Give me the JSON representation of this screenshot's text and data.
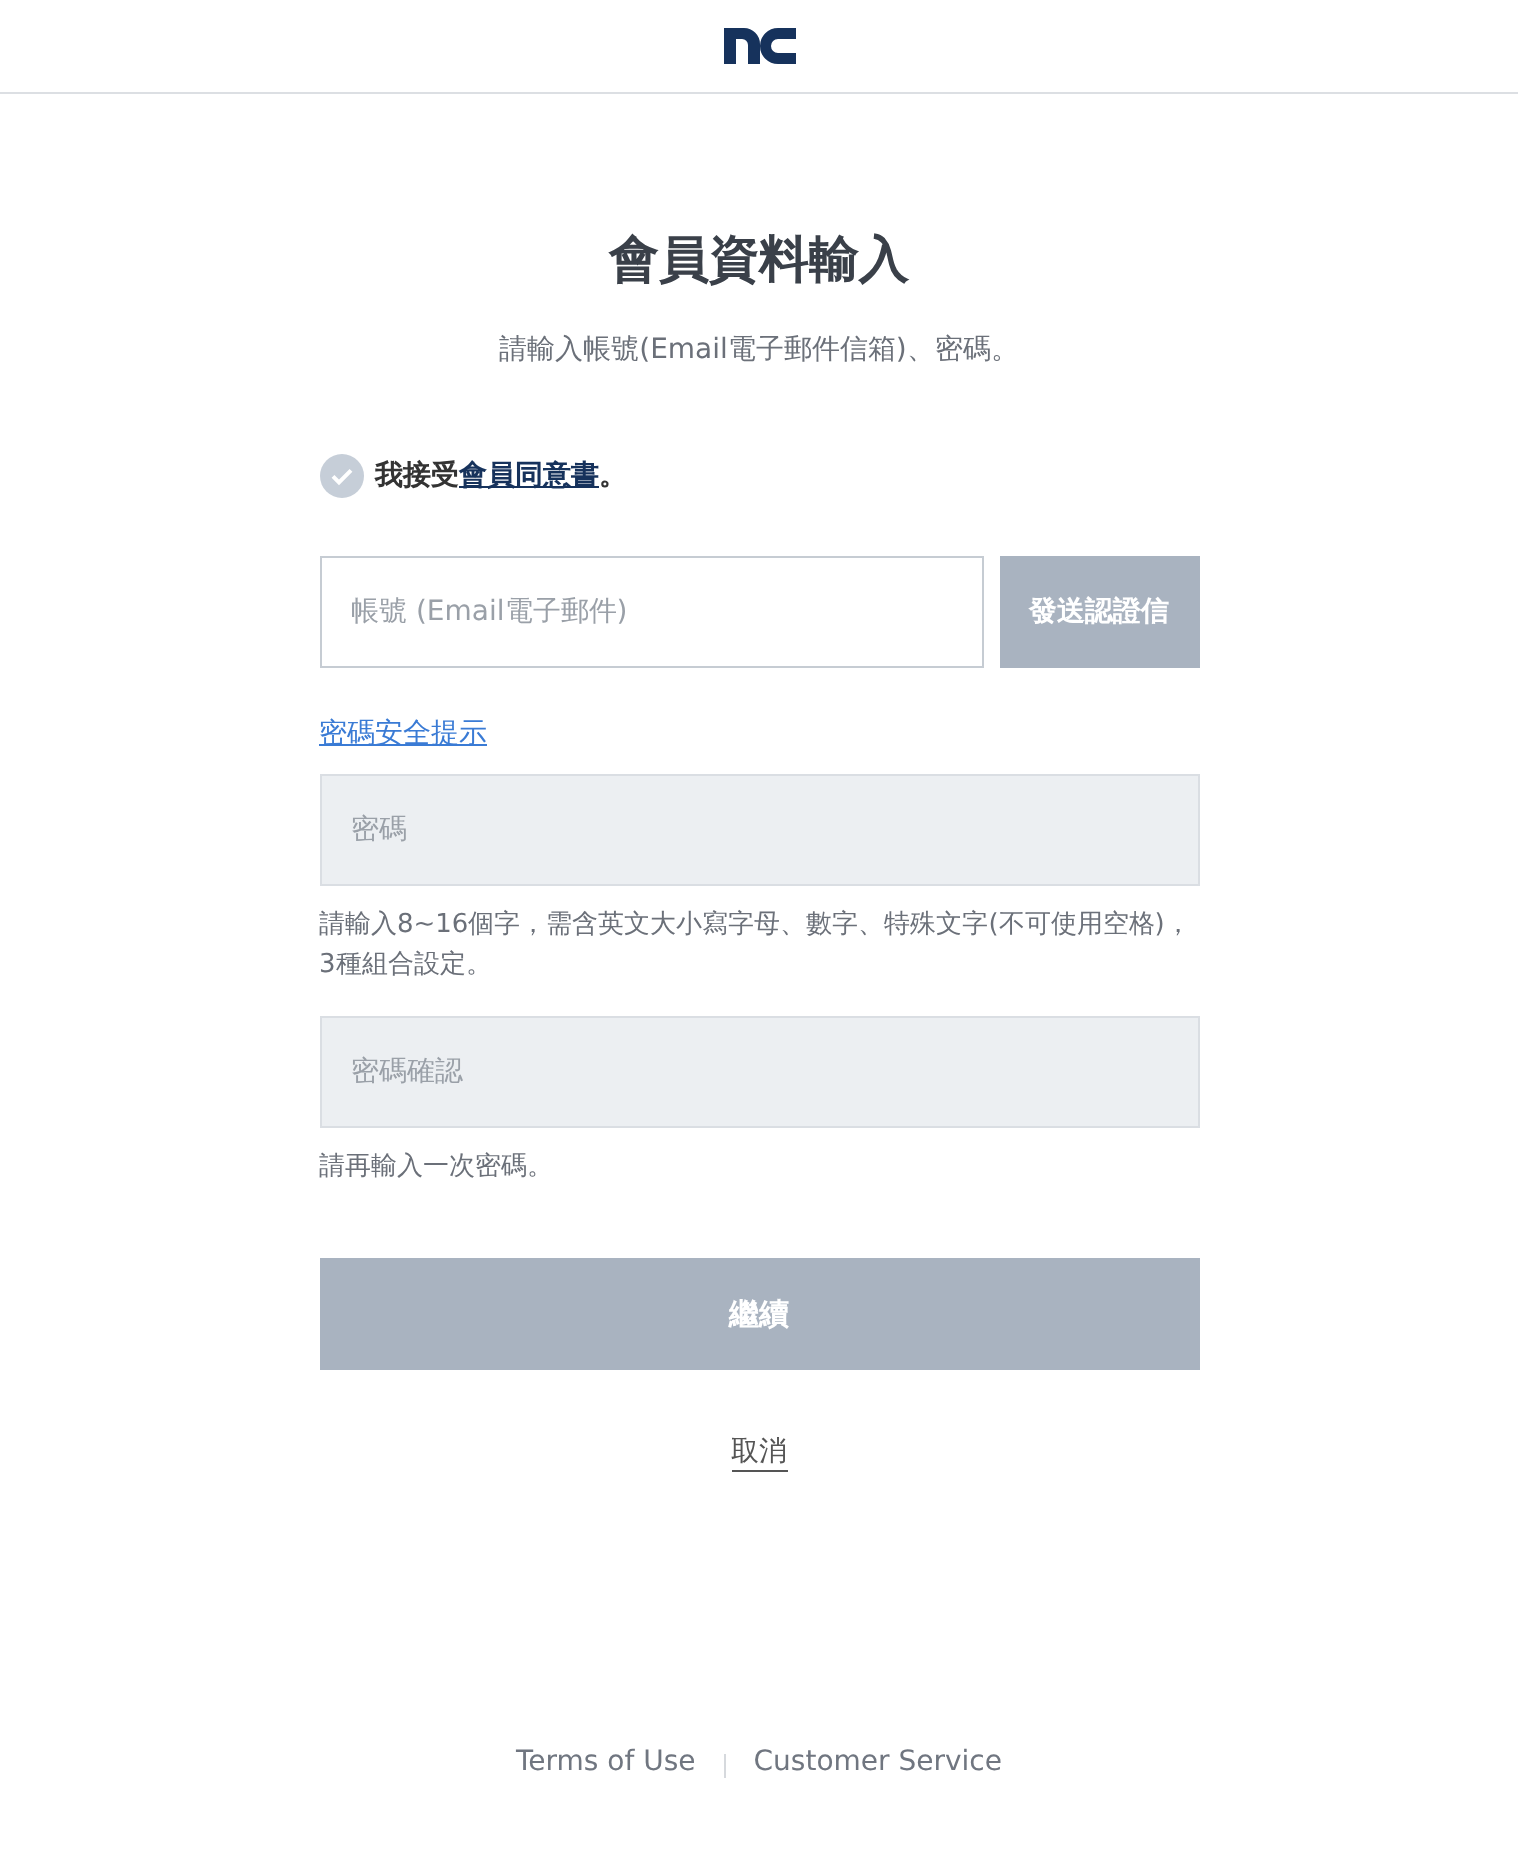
{
  "header": {
    "logo": {
      "kind": "logo"
    }
  },
  "title": "會員資料輸入",
  "subtitle": "請輸入帳號(Email電子郵件信箱)、密碼。",
  "agreement": {
    "checked": false,
    "prefix": "我接受",
    "link": "會員同意書",
    "suffix": "。"
  },
  "email": {
    "placeholder": "帳號 (Email電子郵件)",
    "disabled": false,
    "button": {
      "label": "發送認證信",
      "disabled": true
    }
  },
  "password_tips_link": "密碼安全提示",
  "password": {
    "placeholder": "密碼",
    "disabled": true,
    "hint": "請輸入8~16個字，需含英文大小寫字母、數字、特殊文字(不可使用空格)，3種組合設定。"
  },
  "password_confirm": {
    "placeholder": "密碼確認",
    "disabled": true,
    "hint": "請再輸入一次密碼。"
  },
  "continue_button": {
    "label": "繼續",
    "disabled": true
  },
  "cancel_link": "取消",
  "footer_links": [
    "Terms of Use",
    "Customer Service"
  ]
}
